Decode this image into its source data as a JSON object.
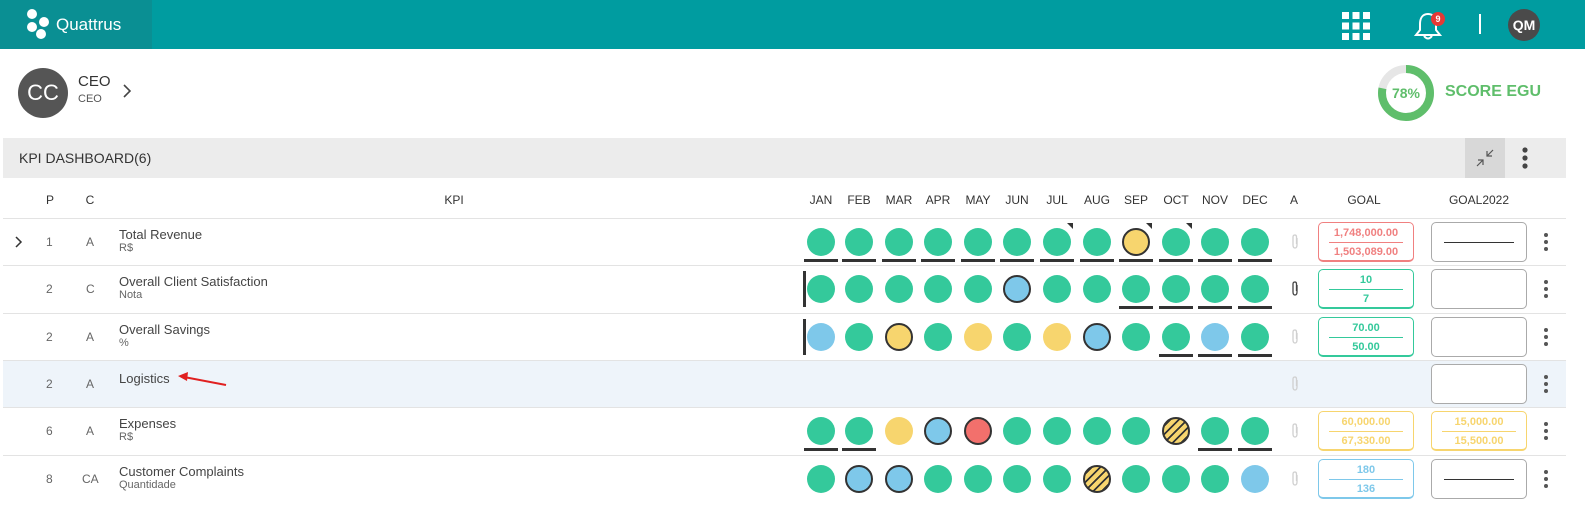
{
  "brand": {
    "name": "Quattrus"
  },
  "topbar": {
    "notification_count": "9",
    "user_initials": "QM"
  },
  "org": {
    "avatar_initials": "CC",
    "title": "CEO",
    "subtitle": "CEO"
  },
  "score": {
    "percent_label": "78%",
    "percent_value": 78,
    "label": "SCORE EGU",
    "color": "#5fbe6b"
  },
  "dashboard": {
    "title": "KPI DASHBOARD(6)"
  },
  "colors": {
    "green": "#34c99b",
    "blue": "#7ec8ea",
    "yellow": "#f7d56e",
    "red": "#f2706c",
    "goal_red": "#f08080",
    "goal_green": "#34c99b",
    "goal_yellow": "#f7d56e",
    "goal_blue": "#7ec8ea",
    "teal": "#009ca0"
  },
  "table": {
    "headers": {
      "p": "P",
      "c": "C",
      "kpi": "KPI",
      "a": "A",
      "goal": "GOAL",
      "goal2022": "GOAL2022"
    },
    "months": [
      "JAN",
      "FEB",
      "MAR",
      "APR",
      "MAY",
      "JUN",
      "JUL",
      "AUG",
      "SEP",
      "OCT",
      "NOV",
      "DEC"
    ],
    "rows": [
      {
        "p": "1",
        "c": "A",
        "name": "Total Revenue",
        "unit": "R$",
        "expand": true,
        "dots": [
          {
            "color": "green",
            "underline": true
          },
          {
            "color": "green",
            "underline": true
          },
          {
            "color": "green",
            "underline": true
          },
          {
            "color": "green",
            "underline": true
          },
          {
            "color": "green",
            "underline": true
          },
          {
            "color": "green",
            "underline": true
          },
          {
            "color": "green",
            "underline": true,
            "corner": true
          },
          {
            "color": "green",
            "underline": true
          },
          {
            "color": "yellow",
            "ring": true,
            "underline": true,
            "corner": true
          },
          {
            "color": "green",
            "underline": true,
            "corner": true
          },
          {
            "color": "green",
            "underline": true
          },
          {
            "color": "green",
            "underline": true
          }
        ],
        "clip": "faded",
        "goal": {
          "v1": "1,748,000.00",
          "v2": "1,503,089.00",
          "color": "goal_red"
        },
        "goal2022": {
          "dash": true
        }
      },
      {
        "p": "2",
        "c": "C",
        "name": "Overall Client Satisfaction",
        "unit": "Nota",
        "vbar": true,
        "dots": [
          {
            "color": "green"
          },
          {
            "color": "green"
          },
          {
            "color": "green"
          },
          {
            "color": "green"
          },
          {
            "color": "green"
          },
          {
            "color": "blue",
            "ring": true
          },
          {
            "color": "green"
          },
          {
            "color": "green"
          },
          {
            "color": "green",
            "underline": true
          },
          {
            "color": "green",
            "underline": true
          },
          {
            "color": "green",
            "underline": true
          },
          {
            "color": "green",
            "underline": true
          }
        ],
        "clip": "dark",
        "goal": {
          "v1": "10",
          "v2": "7",
          "color": "goal_green"
        },
        "goal2022": {
          "empty": true
        }
      },
      {
        "p": "2",
        "c": "A",
        "name": "Overall Savings",
        "unit": "%",
        "vbar": true,
        "dots": [
          {
            "color": "blue"
          },
          {
            "color": "green"
          },
          {
            "color": "yellow",
            "ring": true
          },
          {
            "color": "green"
          },
          {
            "color": "yellow"
          },
          {
            "color": "green"
          },
          {
            "color": "yellow"
          },
          {
            "color": "blue",
            "ring": true
          },
          {
            "color": "green"
          },
          {
            "color": "green",
            "underline": true
          },
          {
            "color": "blue",
            "underline": true
          },
          {
            "color": "green",
            "underline": true
          }
        ],
        "clip": "faded",
        "goal": {
          "v1": "70.00",
          "v2": "50.00",
          "color": "goal_green"
        },
        "goal2022": {
          "empty": true
        }
      },
      {
        "p": "2",
        "c": "A",
        "name": "Logistics",
        "unit": "",
        "highlight": true,
        "dots": [],
        "clip": "faded",
        "goal": null,
        "goal2022": {
          "empty": true
        }
      },
      {
        "p": "6",
        "c": "A",
        "name": "Expenses",
        "unit": "R$",
        "dots": [
          {
            "color": "green",
            "underline": true
          },
          {
            "color": "green",
            "underline": true
          },
          {
            "color": "yellow"
          },
          {
            "color": "blue",
            "ring": true
          },
          {
            "color": "red",
            "ring": true
          },
          {
            "color": "green"
          },
          {
            "color": "green"
          },
          {
            "color": "green"
          },
          {
            "color": "green"
          },
          {
            "color": "hatch",
            "ring": true
          },
          {
            "color": "green",
            "underline": true
          },
          {
            "color": "green",
            "underline": true
          }
        ],
        "clip": "faded",
        "goal": {
          "v1": "60,000.00",
          "v2": "67,330.00",
          "color": "goal_yellow"
        },
        "goal2022": {
          "v1": "15,000.00",
          "v2": "15,500.00",
          "color": "goal_yellow"
        }
      },
      {
        "p": "8",
        "c": "CA",
        "name": "Customer Complaints",
        "unit": "Quantidade",
        "dots": [
          {
            "color": "green"
          },
          {
            "color": "blue",
            "ring": true
          },
          {
            "color": "blue",
            "ring": true
          },
          {
            "color": "green"
          },
          {
            "color": "green"
          },
          {
            "color": "green"
          },
          {
            "color": "green"
          },
          {
            "color": "hatch",
            "ring": true
          },
          {
            "color": "green"
          },
          {
            "color": "green"
          },
          {
            "color": "green"
          },
          {
            "color": "blue"
          }
        ],
        "clip": "faded",
        "goal": {
          "v1": "180",
          "v2": "136",
          "color": "goal_blue"
        },
        "goal2022": {
          "dash": true
        }
      }
    ]
  }
}
